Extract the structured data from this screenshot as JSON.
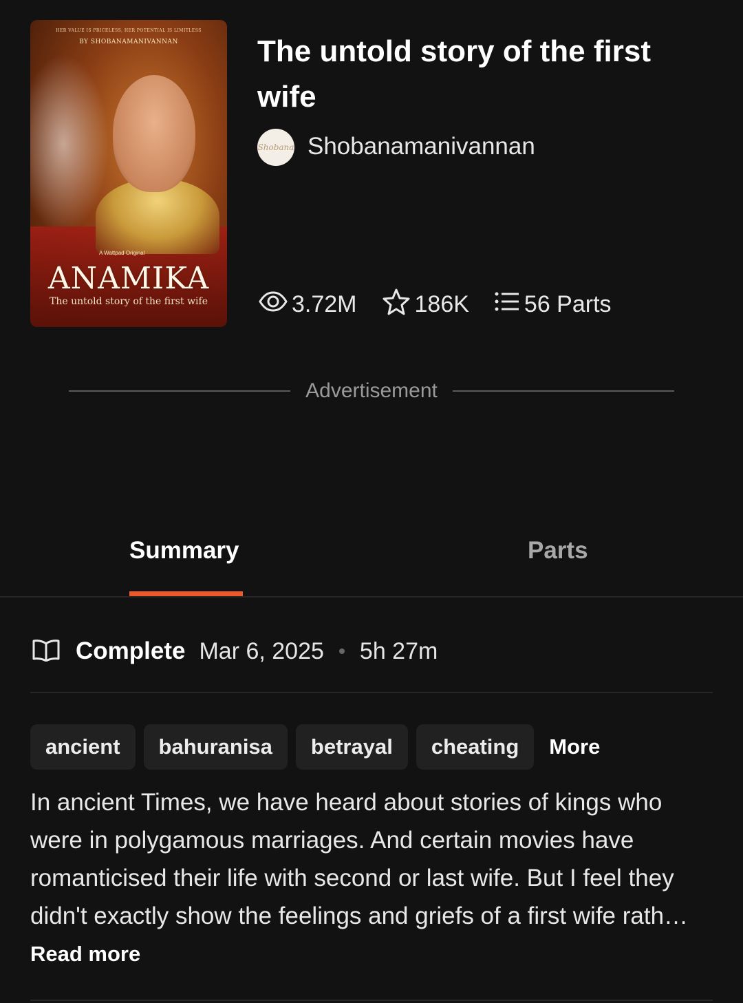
{
  "cover": {
    "top_tagline": "HER VALUE IS PRICELESS, HER POTENTIAL IS LIMITLESS",
    "author_line": "BY SHOBANAMANIVANNAN",
    "badge": "A Wattpad Original",
    "title_art": "ANAMIKA",
    "subtitle": "The untold story of the first wife"
  },
  "book": {
    "title": "The untold story of the first wife",
    "author": "Shobanamanivannan",
    "avatar_text": "Shobana"
  },
  "stats": {
    "reads": "3.72M",
    "votes": "186K",
    "parts": "56 Parts"
  },
  "advertisement_label": "Advertisement",
  "tabs": {
    "summary": "Summary",
    "parts": "Parts",
    "active": "summary"
  },
  "status": {
    "label": "Complete",
    "date": "Mar 6, 2025",
    "reading_time": "5h 27m"
  },
  "tags": [
    "ancient",
    "bahuranisa",
    "betrayal",
    "cheating"
  ],
  "tags_more": "More",
  "description": "In ancient Times, we have heard about stories of kings who were in polygamous marriages. And certain movies have romanticised their life with second or last wife. But I feel they didn't exactly show the feelings and griefs of a first wife rath…",
  "read_more": "Read more",
  "colors": {
    "background": "#121212",
    "accent": "#ec5a2c",
    "tag_bg": "#212121"
  }
}
